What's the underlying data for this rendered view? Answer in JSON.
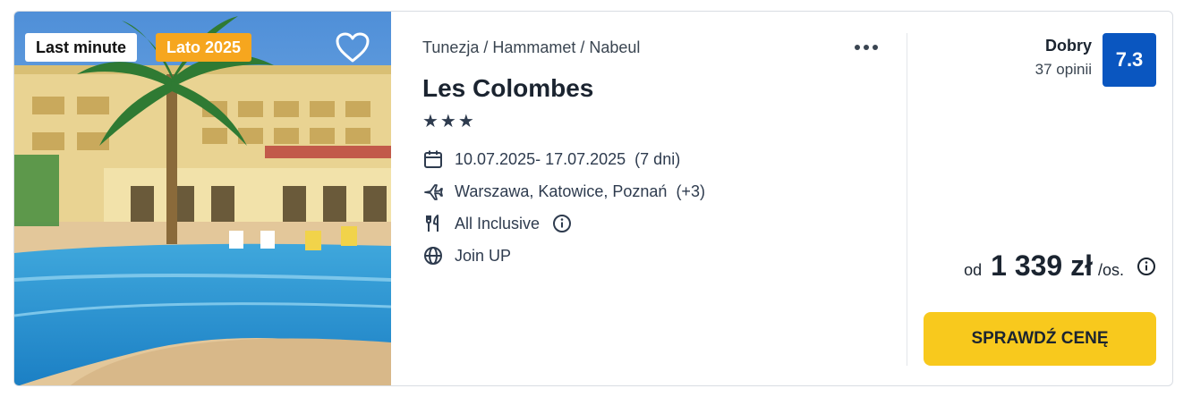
{
  "badges": {
    "last_minute": "Last minute",
    "season": "Lato 2025"
  },
  "breadcrumb": "Tunezja / Hammamet / Nabeul",
  "hotel": {
    "name": "Les Colombes",
    "stars": "★★★"
  },
  "details": {
    "dates": "10.07.2025- 17.07.2025",
    "duration": "(7 dni)",
    "departures": "Warszawa, Katowice, Poznań",
    "departures_extra": "(+3)",
    "board": "All Inclusive",
    "operator": "Join UP"
  },
  "rating": {
    "label": "Dobry",
    "reviews": "37 opinii",
    "score": "7.3"
  },
  "price": {
    "from": "od",
    "amount": "1 339 zł",
    "per": "/os."
  },
  "cta_label": "SPRAWDŹ CENĘ",
  "colors": {
    "accent_yellow": "#f8c91d",
    "rating_blue": "#0a56c0",
    "badge_orange": "#f6a61e"
  },
  "icons": [
    "heart-icon",
    "more-icon",
    "calendar-icon",
    "plane-icon",
    "cutlery-icon",
    "info-icon",
    "globe-icon"
  ]
}
